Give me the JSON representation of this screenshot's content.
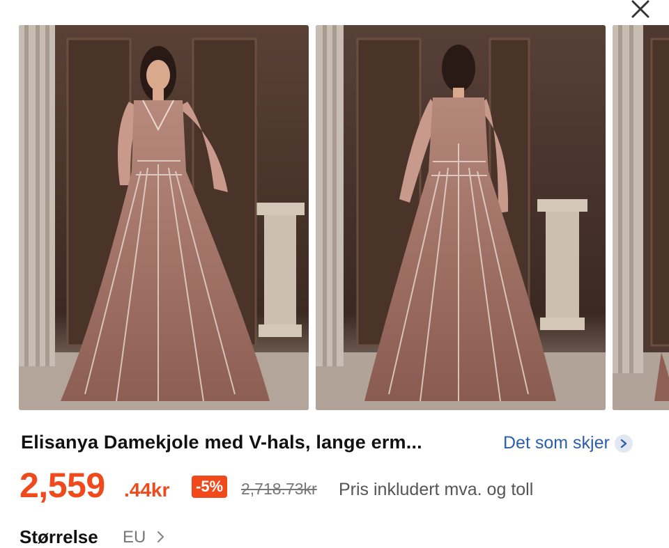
{
  "product": {
    "title": "Elisanya Damekjole med V-hals, lange erm...",
    "similar_link": "Det som skjer",
    "price_main": "2,559",
    "price_decimal": ".44kr",
    "discount": "-5%",
    "original_price": "2,718.73kr",
    "price_note": "Pris inkludert mva. og toll"
  },
  "size": {
    "label": "Størrelse",
    "value": "EU"
  },
  "gallery": {
    "images": [
      "dress-front-photo",
      "dress-back-photo",
      "dress-partial-photo"
    ]
  },
  "colors": {
    "accent": "#f04a1c",
    "link": "#2c5fa8",
    "dress": "#9a6a60"
  },
  "icons": {
    "close": "close-icon",
    "chevron": "chevron-right-icon"
  }
}
